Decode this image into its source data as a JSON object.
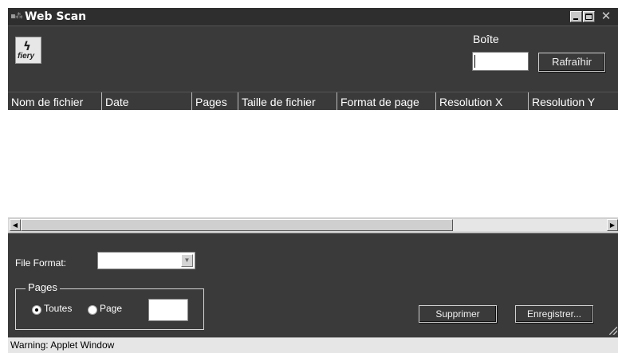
{
  "window": {
    "title": "Web Scan",
    "app_icon": "hub-icon",
    "controls": {
      "minimize": "minimize-icon",
      "maximize": "maximize-icon",
      "close": "close-icon"
    }
  },
  "header": {
    "logo_text": "fiery",
    "logo_icon": "fiery-bolt-icon",
    "boite_label": "Boîte",
    "boite_value": "",
    "refresh_label": "Rafraîhir"
  },
  "table": {
    "columns": [
      "Nom de fichier",
      "Date",
      "Pages",
      "Taille de fichier",
      "Format de page",
      "Resolution X",
      "Resolution Y"
    ],
    "rows": []
  },
  "controls": {
    "file_format_label": "File Format:",
    "file_format_value": "",
    "pages_group_label": "Pages",
    "radio_toutes_label": "Toutes",
    "radio_page_label": "Page",
    "selected_pages_option": "Toutes",
    "page_value": "",
    "delete_label": "Supprimer",
    "save_label": "Enregistrer..."
  },
  "status": {
    "text": "Warning: Applet Window"
  }
}
